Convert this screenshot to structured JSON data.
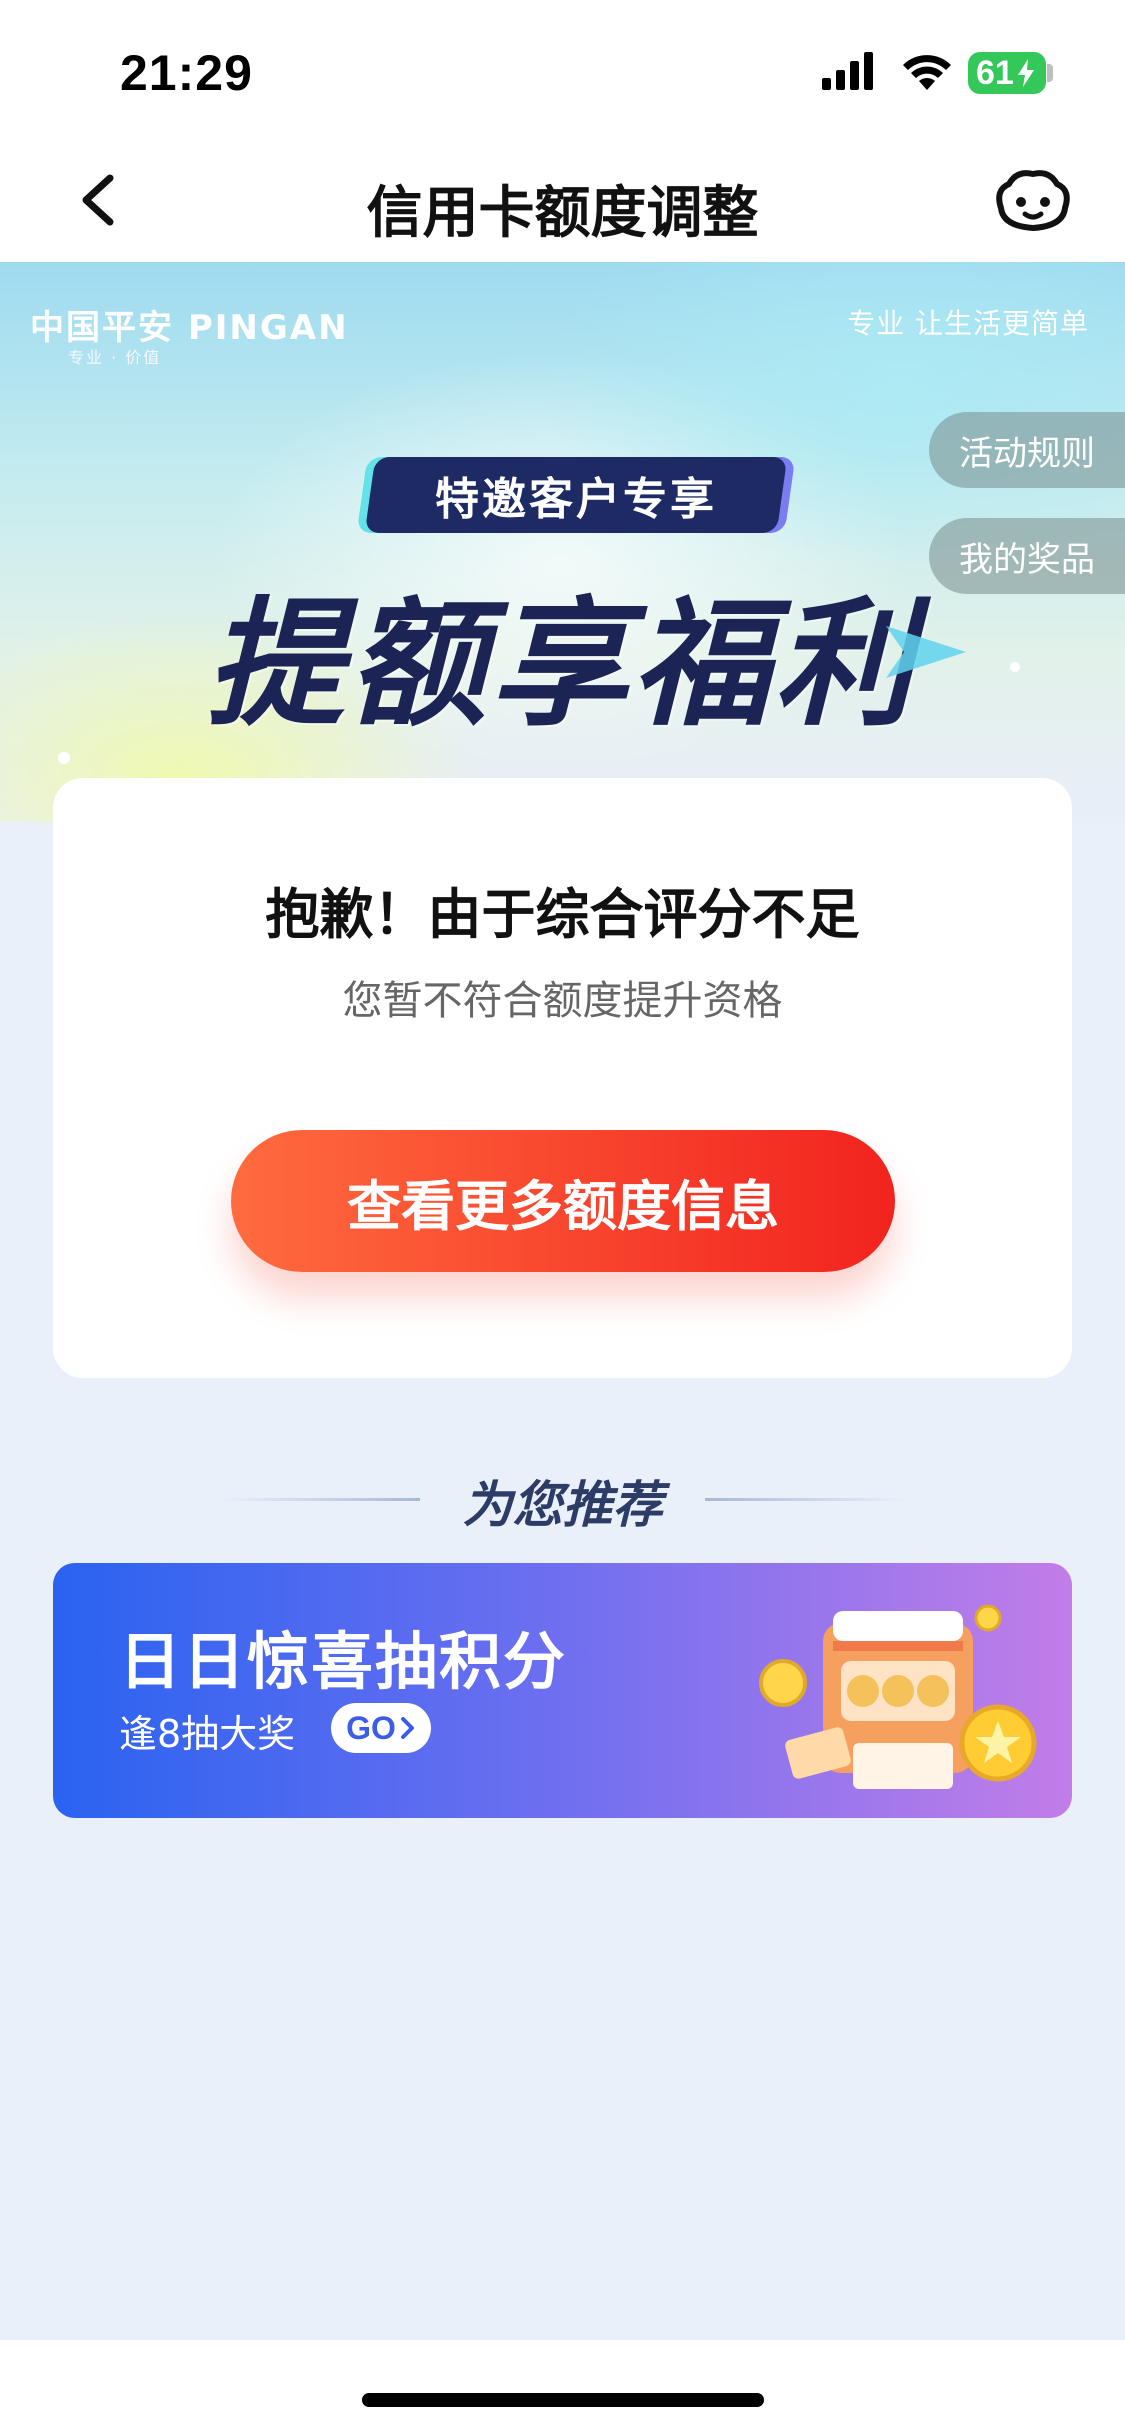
{
  "status_bar": {
    "time": "21:29",
    "battery_level": "61",
    "icons": [
      "signal-icon",
      "wifi-icon",
      "battery-icon"
    ]
  },
  "nav": {
    "title": "信用卡额度调整",
    "left_icon": "back-icon",
    "right_icon": "assistant-icon"
  },
  "hero": {
    "brand_logo": "中国平安 PINGAN",
    "brand_sub": "专业 · 价值",
    "slogan": "专业 让生活更简单",
    "tag": "特邀客户专享",
    "headline": "提额享福利",
    "side_buttons": {
      "rules": "活动规则",
      "prizes": "我的奖品"
    }
  },
  "result": {
    "title": "抱歉！由于综合评分不足",
    "description": "您暂不符合额度提升资格",
    "cta_label": "查看更多额度信息"
  },
  "recommend": {
    "section_title": "为您推荐",
    "promo": {
      "title": "日日惊喜抽积分",
      "subtitle": "逢8抽大奖",
      "go_label": "GO",
      "image_icon": "slot-machine-icon"
    }
  },
  "colors": {
    "cta_start": "#ff6b3f",
    "cta_end": "#f2231e",
    "promo_start": "#2a63f0",
    "promo_end": "#c27de8",
    "page_bg": "#eaf0fa",
    "headline": "#1b2454"
  }
}
